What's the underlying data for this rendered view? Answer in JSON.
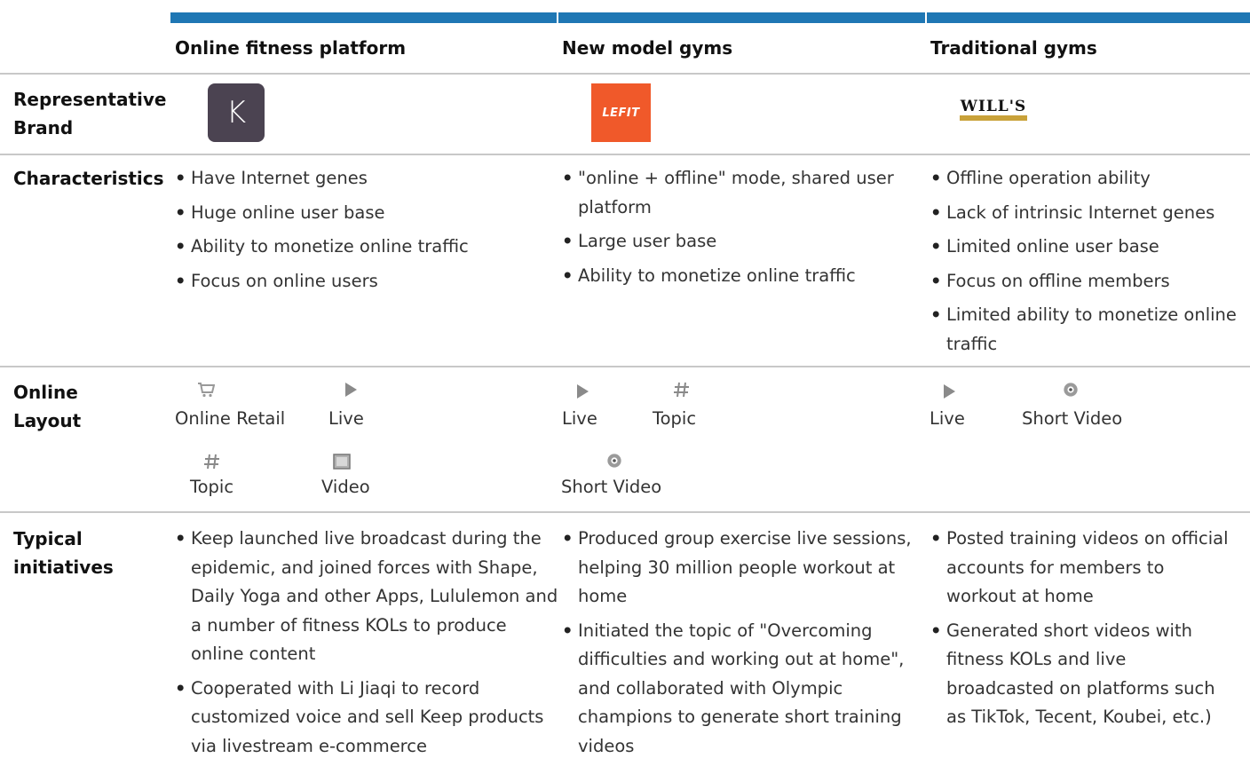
{
  "columns": {
    "online": "Online fitness platform",
    "newmodel": "New model gyms",
    "traditional": "Traditional gyms"
  },
  "rows": {
    "brand": "Representative Brand",
    "characteristics": "Characteristics",
    "layout": "Online Layout",
    "initiatives": "Typical initiatives"
  },
  "brands": {
    "online_logo": "K",
    "newmodel_logo": "LEFIT",
    "traditional_logo": "WILL'S"
  },
  "characteristics": {
    "online": [
      "Have Internet genes",
      "Huge online user base",
      "Ability to monetize online traffic",
      "Focus on online users"
    ],
    "newmodel": [
      "\"online + offline\" mode, shared user platform",
      "Large user base",
      "Ability to monetize online traffic"
    ],
    "traditional": [
      "Offline operation ability",
      "Lack of intrinsic Internet genes",
      "Limited online user base",
      "Focus on offline members",
      "Limited ability to monetize online traffic"
    ]
  },
  "layout": {
    "online": [
      {
        "label": "Online Retail",
        "icon": "cart-icon"
      },
      {
        "label": "Live",
        "icon": "play-icon"
      },
      {
        "label": "Topic",
        "icon": "hashtag-icon"
      },
      {
        "label": "Video",
        "icon": "video-icon"
      }
    ],
    "newmodel": [
      {
        "label": "Live",
        "icon": "play-icon"
      },
      {
        "label": "Topic",
        "icon": "hashtag-icon"
      },
      {
        "label": "Short Video",
        "icon": "short-video-icon"
      }
    ],
    "traditional": [
      {
        "label": "Live",
        "icon": "play-icon"
      },
      {
        "label": "Short Video",
        "icon": "short-video-icon"
      }
    ]
  },
  "initiatives": {
    "online": [
      "Keep launched live broadcast during the epidemic, and joined forces with Shape, Daily Yoga and other Apps, Lululemon and a number of fitness KOLs to produce online content",
      "Cooperated with Li Jiaqi to record customized voice and sell Keep products via livestream e-commerce"
    ],
    "newmodel": [
      "Produced group exercise live sessions, helping 30 million people workout at home",
      "Initiated the topic of \"Overcoming difficulties and working out at home\", and collaborated with Olympic champions to generate short training videos"
    ],
    "traditional": [
      "Posted training videos on official accounts for members to workout at home",
      "Generated short videos with fitness KOLs and live broadcasted on platforms such as TikTok, Tecent, Koubei, etc.)"
    ]
  },
  "colors": {
    "accent": "#1f77b4",
    "keep": "#4b4351",
    "lefit": "#f0592a",
    "wills_bar": "#c9a23a"
  }
}
